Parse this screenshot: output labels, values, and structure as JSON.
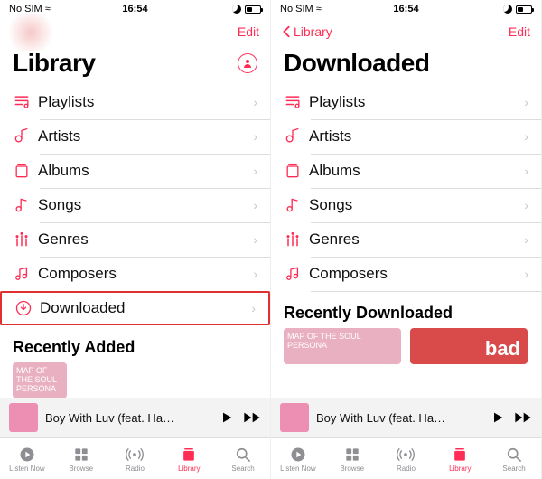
{
  "left": {
    "status": {
      "carrier": "No SIM ≈",
      "time": "16:54"
    },
    "nav": {
      "back": "",
      "edit": "Edit"
    },
    "title": "Library",
    "showAvatar": true,
    "rows": [
      {
        "icon": "playlists",
        "label": "Playlists"
      },
      {
        "icon": "artists",
        "label": "Artists"
      },
      {
        "icon": "albums",
        "label": "Albums"
      },
      {
        "icon": "songs",
        "label": "Songs"
      },
      {
        "icon": "genres",
        "label": "Genres"
      },
      {
        "icon": "composers",
        "label": "Composers"
      },
      {
        "icon": "downloaded",
        "label": "Downloaded",
        "highlight": true
      }
    ],
    "section": "Recently Added",
    "cards": [
      {
        "text": "MAP OF THE SOUL  PERSONA",
        "style": "pink-half"
      }
    ],
    "nowPlaying": {
      "title": "Boy With Luv (feat. Ha…"
    },
    "tabs": [
      {
        "icon": "listen",
        "label": "Listen Now"
      },
      {
        "icon": "browse",
        "label": "Browse"
      },
      {
        "icon": "radio",
        "label": "Radio"
      },
      {
        "icon": "library",
        "label": "Library",
        "active": true
      },
      {
        "icon": "search",
        "label": "Search"
      }
    ]
  },
  "right": {
    "status": {
      "carrier": "No SIM ≈",
      "time": "16:54"
    },
    "nav": {
      "back": "Library",
      "edit": "Edit"
    },
    "title": "Downloaded",
    "showAvatar": false,
    "rows": [
      {
        "icon": "playlists",
        "label": "Playlists"
      },
      {
        "icon": "artists",
        "label": "Artists"
      },
      {
        "icon": "albums",
        "label": "Albums"
      },
      {
        "icon": "songs",
        "label": "Songs"
      },
      {
        "icon": "genres",
        "label": "Genres"
      },
      {
        "icon": "composers",
        "label": "Composers"
      }
    ],
    "section": "Recently Downloaded",
    "cards": [
      {
        "text": "MAP OF THE SOUL  PERSONA",
        "style": "pink"
      },
      {
        "text": "bad",
        "style": "red"
      }
    ],
    "nowPlaying": {
      "title": "Boy With Luv (feat. Ha…"
    },
    "tabs": [
      {
        "icon": "listen",
        "label": "Listen Now"
      },
      {
        "icon": "browse",
        "label": "Browse"
      },
      {
        "icon": "radio",
        "label": "Radio"
      },
      {
        "icon": "library",
        "label": "Library",
        "active": true
      },
      {
        "icon": "search",
        "label": "Search"
      }
    ]
  }
}
